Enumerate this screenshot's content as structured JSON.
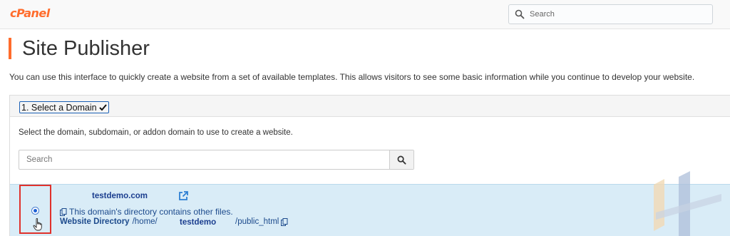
{
  "header": {
    "logo": "cPanel",
    "search_placeholder": "Search"
  },
  "page": {
    "title": "Site Publisher",
    "intro": "You can use this interface to quickly create a website from a set of available templates. This allows visitors to see some basic information while you continue to develop your website."
  },
  "step": {
    "label": "1. Select a Domain",
    "instruction": "Select the domain, subdomain, or addon domain to use to create a website.",
    "search_placeholder": "Search"
  },
  "domains": [
    {
      "name": "testdemo.com",
      "selected": true,
      "note": "This domain's directory contains other files.",
      "directory_label": "Website Directory",
      "directory_prefix": "/home/",
      "directory_user": "testdemo",
      "directory_suffix": "/public_html"
    }
  ],
  "colors": {
    "brand": "#ff6c2c",
    "link": "#1b3e8f",
    "selected_row": "#d9ecf7",
    "highlight_box": "#e0312b"
  },
  "icons": [
    "search-icon",
    "checkmark-icon",
    "external-link-icon",
    "copy-icon",
    "pointer-cursor-icon"
  ]
}
